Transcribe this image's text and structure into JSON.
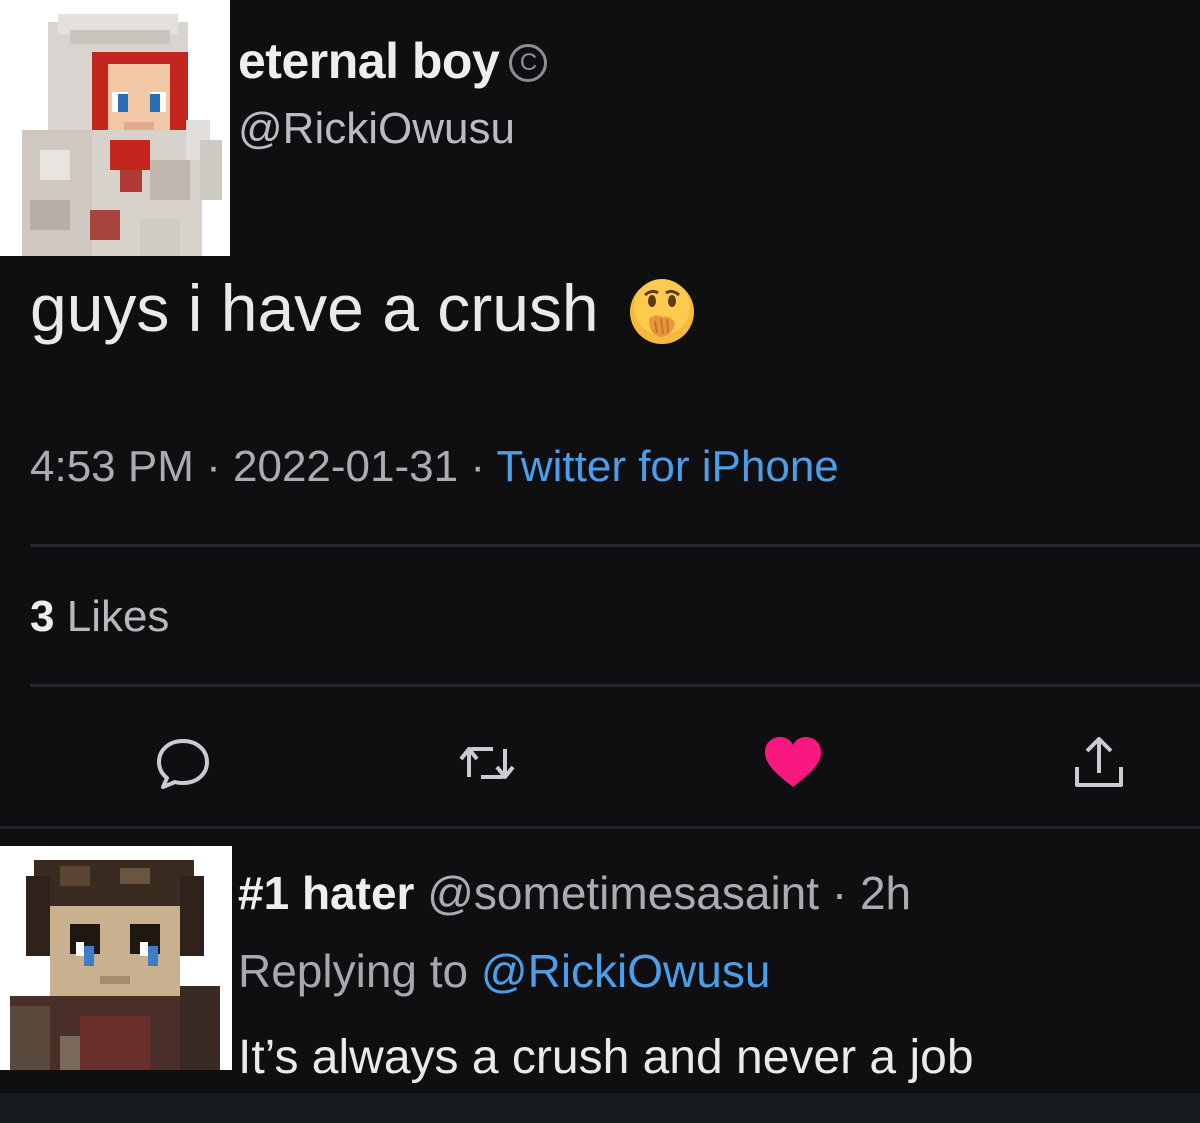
{
  "tweet": {
    "display_name": "eternal boy",
    "badge_symbol": "C",
    "handle": "@RickiOwusu",
    "text": "guys i have a crush",
    "emoji": "face-with-hand-over-mouth",
    "time": "4:53 PM",
    "date": "2022-01-31",
    "separator": "·",
    "source": "Twitter for iPhone",
    "likes_count": "3",
    "likes_label": "Likes",
    "liked": true
  },
  "actions": {
    "reply_icon": "speech-bubble-icon",
    "retweet_icon": "retweet-icon",
    "like_icon": "heart-icon",
    "share_icon": "share-icon"
  },
  "reply": {
    "display_name": "#1 hater",
    "handle": "@sometimesasaint",
    "time_ago": "2h",
    "separator": "·",
    "replying_to_label": "Replying to",
    "replying_to_handle": "@RickiOwusu",
    "text": "It’s always a crush and never a job"
  },
  "colors": {
    "background": "#0f0f12",
    "link_blue": "#4b9fea",
    "like_pink": "#f91880",
    "muted_text": "#a9acb0"
  }
}
